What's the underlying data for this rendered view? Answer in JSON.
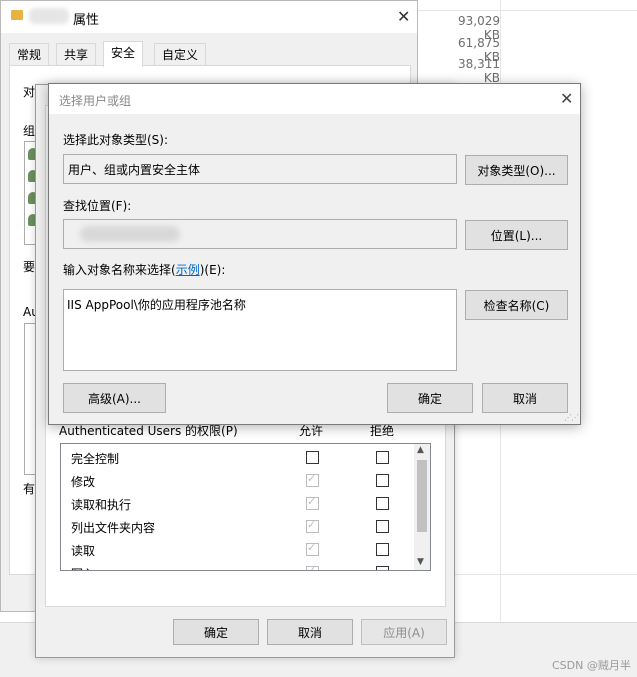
{
  "explorer": {
    "sizes": [
      "93,029 KB",
      "61,875 KB",
      "38,311 KB"
    ]
  },
  "properties_window": {
    "title": "属性",
    "tabs": [
      "常规",
      "共享",
      "安全",
      "自定义"
    ],
    "fragments": {
      "obj": "对",
      "group": "组",
      "want": "要",
      "au": "Au",
      "have": "有"
    }
  },
  "permissions_window": {
    "header": {
      "perm_for": "Authenticated Users 的权限(P)",
      "allow": "允许",
      "deny": "拒绝"
    },
    "rows": [
      {
        "name": "完全控制",
        "allow": false,
        "allow_disabled": false,
        "deny": false
      },
      {
        "name": "修改",
        "allow": true,
        "allow_disabled": true,
        "deny": false
      },
      {
        "name": "读取和执行",
        "allow": true,
        "allow_disabled": true,
        "deny": false
      },
      {
        "name": "列出文件夹内容",
        "allow": true,
        "allow_disabled": true,
        "deny": false
      },
      {
        "name": "读取",
        "allow": true,
        "allow_disabled": true,
        "deny": false
      },
      {
        "name": "写入",
        "allow": true,
        "allow_disabled": true,
        "deny": false
      }
    ],
    "buttons": {
      "ok": "确定",
      "cancel": "取消",
      "apply": "应用(A)"
    }
  },
  "select_dialog": {
    "title": "选择用户或组",
    "object_type_label": "选择此对象类型(S):",
    "object_type_value": "用户、组或内置安全主体",
    "object_type_button": "对象类型(O)...",
    "location_label": "查找位置(F):",
    "location_button": "位置(L)...",
    "name_label_prefix": "输入对象名称来选择(",
    "name_label_link": "示例",
    "name_label_suffix": ")(E):",
    "name_input_value": "IIS AppPool\\你的应用程序池名称",
    "check_names_button": "检查名称(C)",
    "advanced_button": "高级(A)...",
    "ok_button": "确定",
    "cancel_button": "取消"
  },
  "watermark": "CSDN @贼月半"
}
